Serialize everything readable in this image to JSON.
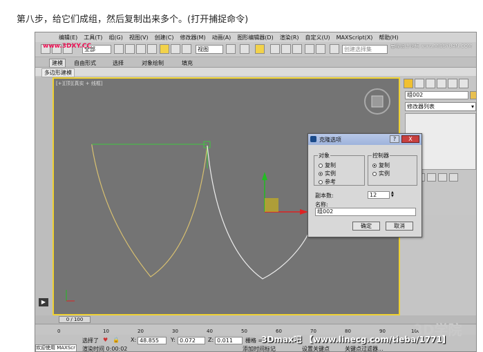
{
  "caption": "第八步，给它们成组，然后复制出来多个。(打开捕捉命令)",
  "menu": [
    "编辑(E)",
    "工具(T)",
    "组(G)",
    "视图(V)",
    "创建(C)",
    "修改器(M)",
    "动画(A)",
    "图形编辑器(D)",
    "渲染(R)",
    "自定义(U)",
    "MAXScript(X)",
    "帮助(H)"
  ],
  "toolbar": {
    "filter_value": "全部",
    "view_value": "视图",
    "selection_set_placeholder": "创建选择集"
  },
  "tabs": [
    "建模",
    "自由形式",
    "选择",
    "对象绘制",
    "填充"
  ],
  "subtab": "多边形建模",
  "viewport_label": "[+][顶][真实 + 线框]",
  "command_panel": {
    "object_name": "组002",
    "modifier_list": "修改器列表"
  },
  "dialog": {
    "title": "克隆选项",
    "help": "?",
    "close": "X",
    "object_group": "对象",
    "object_options": [
      {
        "label": "复制",
        "checked": false
      },
      {
        "label": "实例",
        "checked": true
      },
      {
        "label": "参考",
        "checked": false
      }
    ],
    "controller_group": "控制器",
    "controller_options": [
      {
        "label": "复制",
        "checked": true
      },
      {
        "label": "实例",
        "checked": false
      }
    ],
    "copies_label": "副本数:",
    "copies_value": "12",
    "name_label": "名称:",
    "name_value": "组002",
    "ok": "确定",
    "cancel": "取消"
  },
  "timeline": {
    "frame": "0 / 100",
    "ticks": [
      "0",
      "10",
      "20",
      "30",
      "40",
      "50",
      "60",
      "70",
      "80",
      "90",
      "100"
    ]
  },
  "status": {
    "welcome": "欢迎使用 MAXScr",
    "selected": "选择了",
    "x_label": "X:",
    "x_value": "48.855",
    "y_label": "Y:",
    "y_value": "0.072",
    "z_label": "Z:",
    "z_value": "0.011",
    "grid_label": "栅格 = 10",
    "render_time": "渲染时间 0:00:02",
    "add_time_tag": "添加时间标记",
    "set_key": "设置关键点",
    "key_filters": "关键点过滤器..."
  },
  "watermarks": {
    "bottom": "3Dmax吧 【www.linecg.com/tieba/1771】",
    "corner": "3D学院",
    "top_right": "思缘设计论坛 www.MISSYUAN.COM",
    "logo": "www.3DXY.CC"
  },
  "colors": {
    "viewport_bg": "#747474",
    "viewport_border": "#f0d232",
    "curve_yellow": "#d8c070",
    "curve_white": "#eeeeee",
    "selection_green": "#40c840"
  }
}
